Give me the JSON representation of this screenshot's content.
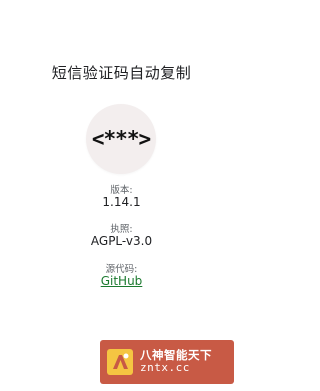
{
  "app": {
    "title": "短信验证码自动复制",
    "logo_text": "<***>"
  },
  "about": {
    "version": {
      "label": "版本:",
      "value": "1.14.1"
    },
    "license": {
      "label": "执照:",
      "value": "AGPL-v3.0"
    },
    "source": {
      "label": "源代码:",
      "link_text": "GitHub"
    }
  },
  "watermark": {
    "line1": "八神智能天下",
    "line2": "zntx.cc"
  },
  "colors": {
    "link": "#1b7a2f",
    "watermark_bg": "#c85a45",
    "logo_bg": "#f3eeee"
  }
}
